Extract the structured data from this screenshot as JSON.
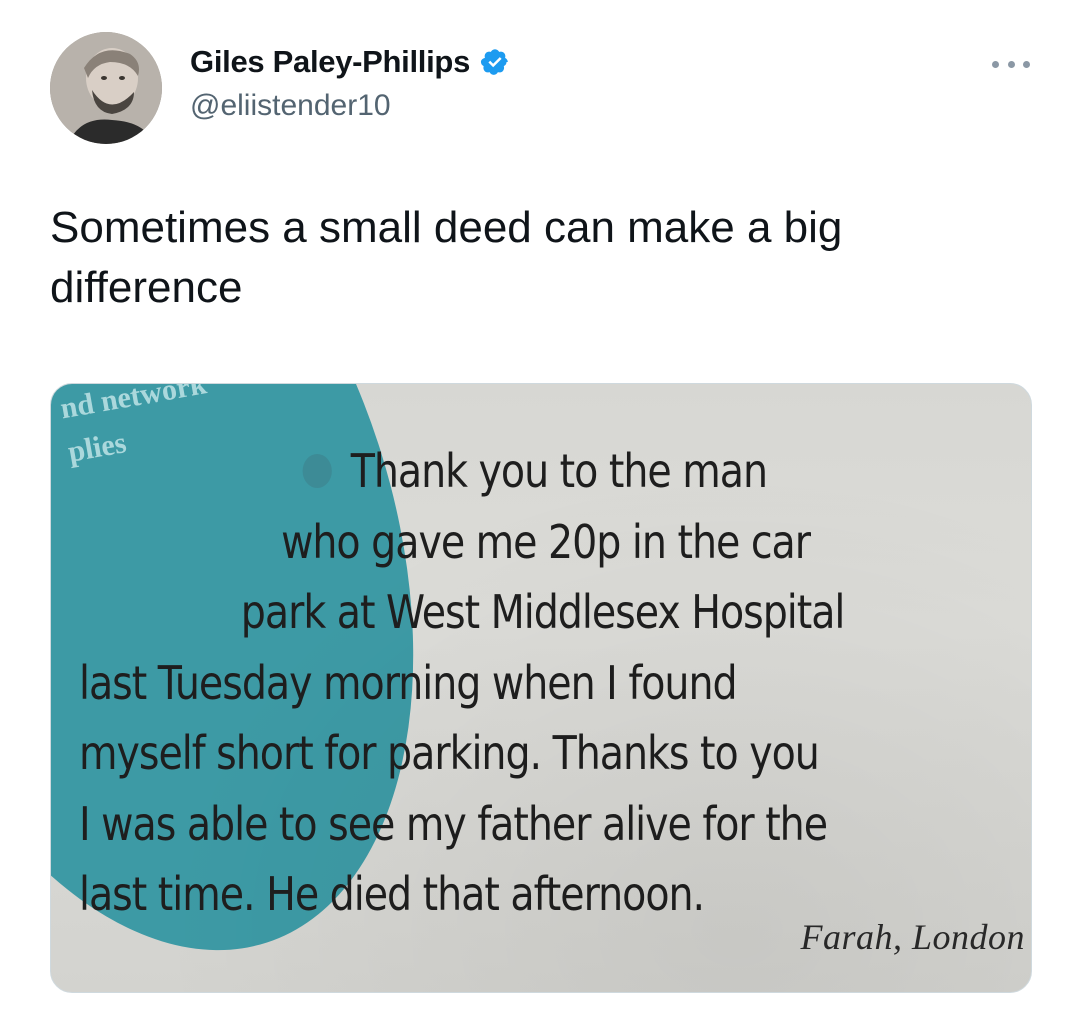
{
  "author": {
    "display_name": "Giles Paley-Phillips",
    "handle": "@eliistender10",
    "verified": true,
    "avatar_icon": "profile-photo-icon"
  },
  "menu": {
    "icon": "more-options-icon"
  },
  "tweet": {
    "text": "Sometimes a small deed can make a big difference"
  },
  "media": {
    "background_fragment": [
      "nd network",
      "plies"
    ],
    "clipping_lines": [
      "Thank you to the man",
      "who gave me 20p in the car",
      "park at West Middlesex Hospital",
      "last Tuesday morning when I found",
      "myself short for parking. Thanks to you",
      "I was able to see my father alive for the",
      "last time. He died that afternoon."
    ],
    "signature": "Farah, London"
  },
  "colors": {
    "verified_blue": "#1d9bf0",
    "teal_accent": "#3d9aa5",
    "handle_gray": "#536471"
  }
}
